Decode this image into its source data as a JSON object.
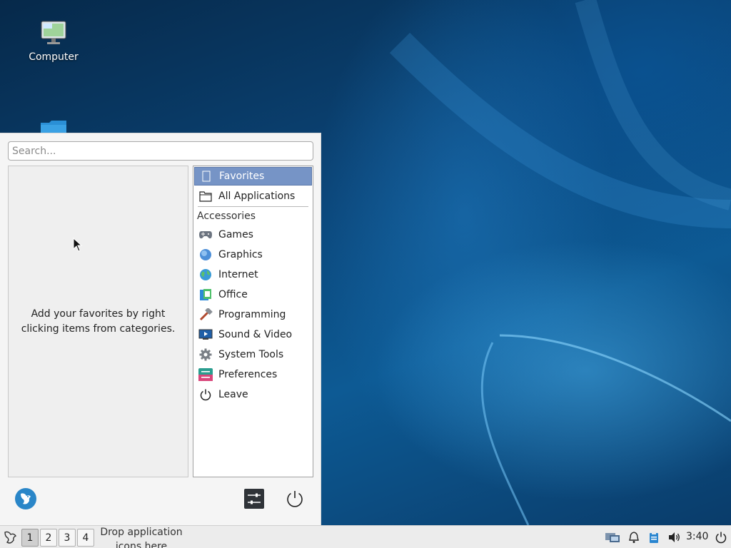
{
  "desktop": {
    "icons": [
      {
        "label": "Computer",
        "icon": "computer-icon"
      },
      {
        "label": "",
        "icon": "folder-icon"
      }
    ]
  },
  "menu": {
    "search_placeholder": "Search...",
    "favorites_empty_text": "Add your favorites by right clicking items from categories.",
    "categories": [
      {
        "label": "Favorites",
        "icon": "bookmark-icon",
        "selected": true
      },
      {
        "label": "All Applications",
        "icon": "folder-icon"
      },
      {
        "label": "Accessories",
        "icon": "",
        "header": true
      },
      {
        "label": "Games",
        "icon": "gamepad-icon"
      },
      {
        "label": "Graphics",
        "icon": "graphics-icon"
      },
      {
        "label": "Internet",
        "icon": "globe-icon"
      },
      {
        "label": "Office",
        "icon": "office-icon"
      },
      {
        "label": "Programming",
        "icon": "hammer-icon"
      },
      {
        "label": "Sound & Video",
        "icon": "media-icon"
      },
      {
        "label": "System Tools",
        "icon": "gear-icon"
      },
      {
        "label": "Preferences",
        "icon": "preferences-icon"
      },
      {
        "label": "Leave",
        "icon": "power-icon"
      }
    ],
    "bottom_buttons": [
      "user-avatar-icon",
      "settings-sliders-icon",
      "power-icon"
    ]
  },
  "taskbar": {
    "workspaces": [
      "1",
      "2",
      "3",
      "4"
    ],
    "active_workspace": "1",
    "drop_label": "Drop application icons here",
    "tray_icons": [
      "network-icon",
      "notification-bell-icon",
      "clipboard-icon",
      "volume-icon"
    ],
    "clock": "3:40",
    "colors": {
      "selection": "#7694c6",
      "panel": "#ececec"
    }
  }
}
